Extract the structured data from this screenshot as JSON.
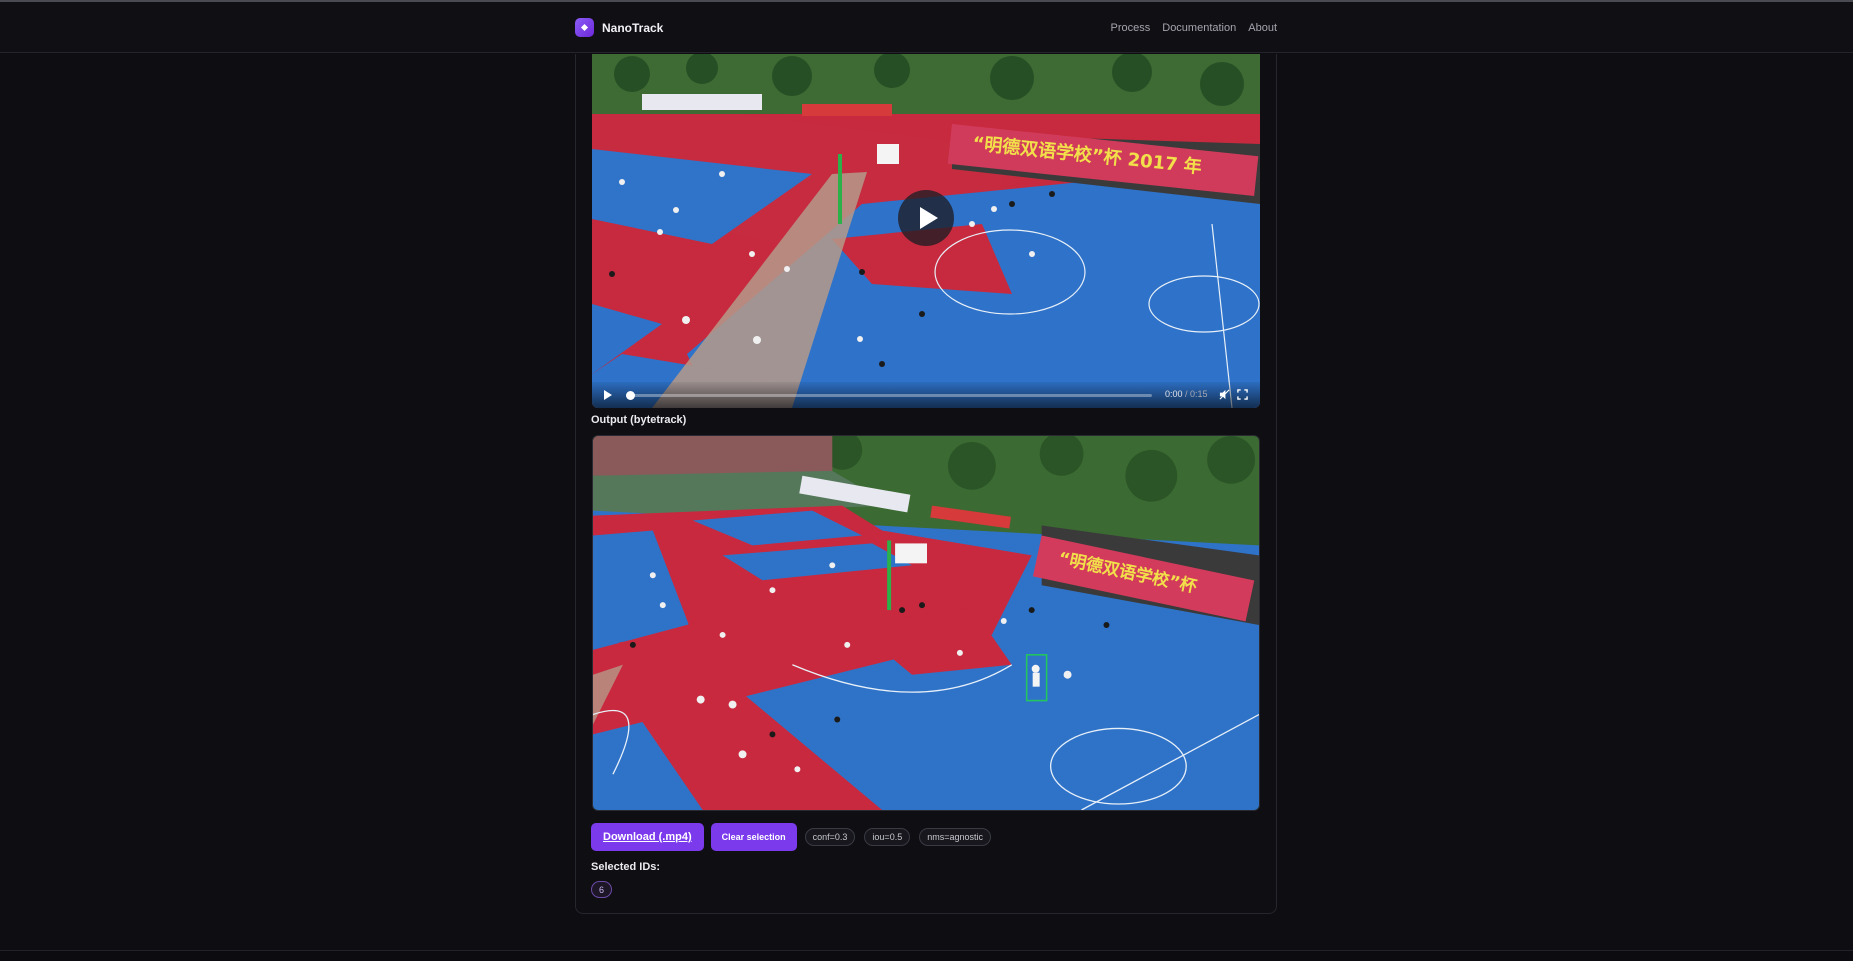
{
  "app": {
    "name": "NanoTrack"
  },
  "nav": {
    "items": [
      "Process",
      "Documentation",
      "About"
    ]
  },
  "input_video": {
    "current_time": "0:00",
    "separator": " / ",
    "duration": "0:15",
    "progress": 0
  },
  "output": {
    "label": "Output (bytetrack)",
    "tracked_box_color": "#22c55e"
  },
  "actions": {
    "download_label": "Download (.mp4)",
    "clear_label": "Clear selection"
  },
  "params": [
    "conf=0.3",
    "iou=0.5",
    "nms=agnostic"
  ],
  "selection": {
    "label": "Selected IDs:",
    "ids": [
      "6"
    ]
  },
  "colors": {
    "accent": "#7c3aed",
    "background": "#0d0d12"
  }
}
